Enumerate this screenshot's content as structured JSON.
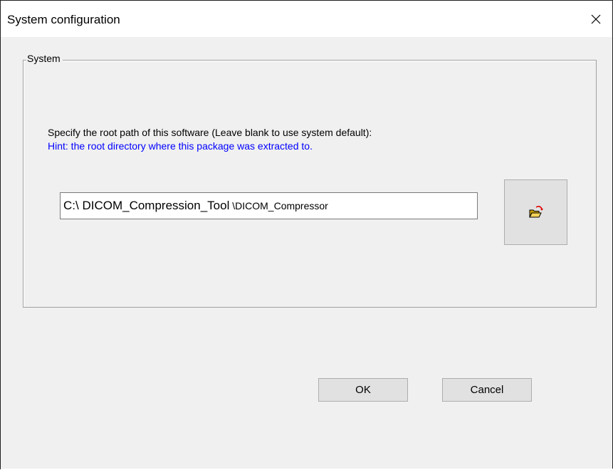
{
  "window": {
    "title": "System configuration"
  },
  "group": {
    "label": "System"
  },
  "description": "Specify the root path of this software (Leave blank to use system default):",
  "hint": "Hint: the root directory where this package was extracted to.",
  "path_field": {
    "prefix": "C:\\ ",
    "middle": "DICOM_Compression_Tool",
    "suffix": " \\DICOM_Compressor"
  },
  "buttons": {
    "ok_label": "OK",
    "cancel_label": "Cancel"
  },
  "icons": {
    "close": "close-icon",
    "browse": "open-folder-icon"
  },
  "colors": {
    "hint_text": "#0000ff",
    "dialog_background": "#f0f0f0",
    "titlebar_background": "#ffffff",
    "button_background": "#e1e1e1"
  }
}
